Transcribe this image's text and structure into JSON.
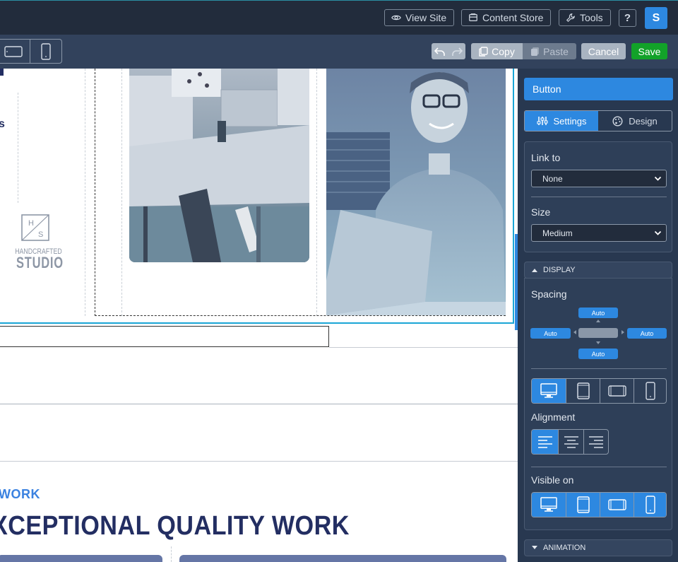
{
  "topbar": {
    "view_site": "View Site",
    "content_store": "Content Store",
    "tools": "Tools",
    "help": "?",
    "avatar_initial": "S"
  },
  "toolbar": {
    "copy": "Copy",
    "paste": "Paste",
    "cancel": "Cancel",
    "save": "Save"
  },
  "canvas": {
    "left_char": "s",
    "logo_monogram_top": "H",
    "logo_monogram_bottom": "S",
    "logo_line1": "HANDCRAFTED",
    "logo_line2": "STUDIO",
    "eyebrow": "WORK",
    "headline": "XCEPTIONAL QUALITY WORK"
  },
  "panel": {
    "title": "Button",
    "tab_settings": "Settings",
    "tab_design": "Design",
    "link_to_label": "Link to",
    "link_to_value": "None",
    "size_label": "Size",
    "size_value": "Medium",
    "display_section": "DISPLAY",
    "spacing_label": "Spacing",
    "spacing_top": "Auto",
    "spacing_left": "Auto",
    "spacing_right": "Auto",
    "spacing_bottom": "Auto",
    "alignment_label": "Alignment",
    "visible_on_label": "Visible on",
    "animation_section": "ANIMATION"
  },
  "colors": {
    "accent": "#2d88e0",
    "save_green": "#12a229",
    "panel_bg": "#283850",
    "topbar_bg": "#222c3c",
    "headline": "#232e62"
  }
}
